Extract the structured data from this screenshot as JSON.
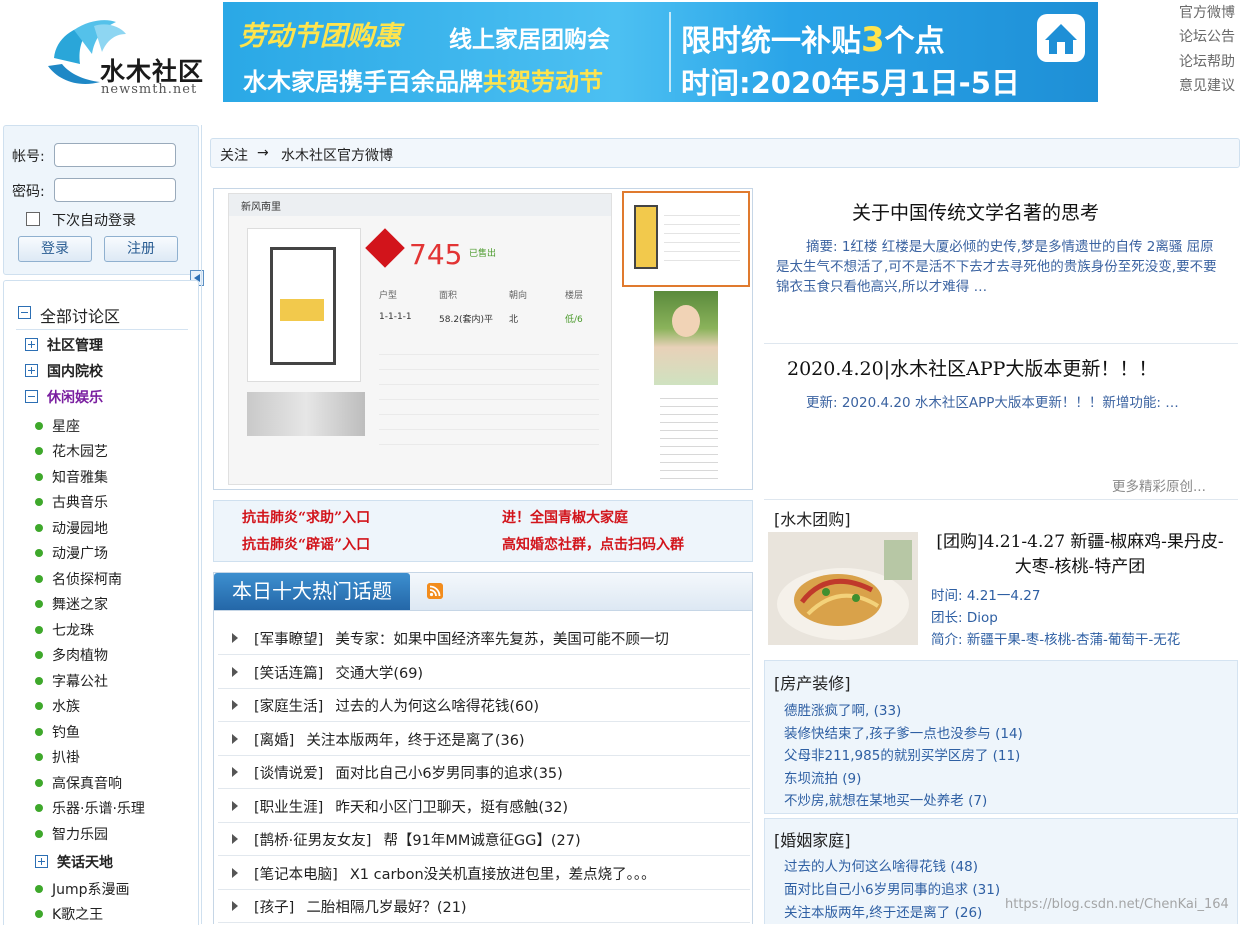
{
  "header": {
    "logo_name": "水木社区",
    "logo_domain": "newsmth.net",
    "banner": {
      "line1": "劳动节团购惠",
      "line2": "线上家居团购会",
      "line3_pre": "水木家居携手百余品牌",
      "line3_hl": "共贺劳动节",
      "line4_pre": "限时统一补贴",
      "line4_hl": "3",
      "line4_post": "个点",
      "line5": "时间:2020年5月1日-5日"
    },
    "top_links": [
      "官方微博",
      "论坛公告",
      "论坛帮助",
      "意见建议"
    ]
  },
  "login": {
    "account_label": "帐号:",
    "password_label": "密码:",
    "remember_label": "下次自动登录",
    "login_button": "登录",
    "register_button": "注册"
  },
  "sidebar": {
    "root": "全部讨论区",
    "groups": [
      {
        "label": "社区管理",
        "state": "collapsed"
      },
      {
        "label": "国内院校",
        "state": "collapsed"
      },
      {
        "label": "休闲娱乐",
        "state": "expanded"
      }
    ],
    "leaves": [
      "星座",
      "花木园艺",
      "知音雅集",
      "古典音乐",
      "动漫园地",
      "动漫广场",
      "名侦探柯南",
      "舞迷之家",
      "七龙珠",
      "多肉植物",
      "字幕公社",
      "水族",
      "钓鱼",
      "扒褂",
      "高保真音响",
      "乐器·乐谱·乐理",
      "智力乐园"
    ],
    "subgroup": "笑话天地",
    "subleaves": [
      "Jump系漫画",
      "K歌之王"
    ]
  },
  "breadcrumb": {
    "follow": "关注",
    "arrow": "→",
    "target": "水木社区官方微博"
  },
  "slide": {
    "shot_title": "新风南里",
    "price": "745",
    "price_tag": "已售出",
    "col_headers": [
      "户型",
      "面积",
      "朝向",
      "楼层"
    ],
    "row": [
      "1-1-1-1",
      "58.2(套内)平",
      "北",
      "低/6"
    ]
  },
  "red_links": [
    "抗击肺炎“求助”入口",
    "进！全国青椒大家庭",
    "抗击肺炎“辟谣”入口",
    "高知婚恋社群，点击扫码入群"
  ],
  "hot": {
    "title": "本日十大热门话题",
    "items": [
      {
        "board": "[军事瞭望]",
        "title": "美专家：如果中国经济率先复苏，美国可能不顾一切"
      },
      {
        "board": "[笑话连篇]",
        "title": "交通大学(69)"
      },
      {
        "board": "[家庭生活]",
        "title": "过去的人为何这么啥得花钱(60)"
      },
      {
        "board": "[离婚]",
        "title": "关注本版两年，终于还是离了(36)"
      },
      {
        "board": "[谈情说爱]",
        "title": "面对比自己小6岁男同事的追求(35)"
      },
      {
        "board": "[职业生涯]",
        "title": "昨天和小区门卫聊天，挺有感触(32)"
      },
      {
        "board": "[鹊桥·征男友女友]",
        "title": "帮【91年MM诚意征GG】(27)"
      },
      {
        "board": "[笔记本电脑]",
        "title": "X1 carbon没关机直接放进包里，差点烧了。。。"
      },
      {
        "board": "[孩子]",
        "title": "二胎相隔几岁最好？(21)"
      }
    ]
  },
  "articles": [
    {
      "title": "关于中国传统文学名著的思考",
      "body": "摘要: 1红楼  红楼是大厦必倾的史传,梦是多情遗世的自传 2离骚 屈原是太生气不想活了,可不是活不下去才去寻死他的贵族身份至死没变,要不要锦衣玉食只看他高兴,所以才难得 …"
    },
    {
      "title": "2020.4.20|水木社区APP大版本更新！！！",
      "body": "更新: 2020.4.20 水木社区APP大版本更新！！！新增功能: …"
    }
  ],
  "more_text": "更多精彩原创...",
  "group_buy": {
    "section": "[水木团购]",
    "title": "[团购]4.21-4.27 新疆-椒麻鸡-果丹皮-大枣-核桃-特产团",
    "time": "时间: 4.21一4.27",
    "leader": "团长: Diop",
    "intro": "简介: 新疆干果-枣-核桃-杏蒲-葡萄干-无花"
  },
  "house": {
    "section": "[房产装修]",
    "links": [
      "德胜涨疯了啊,  (33)",
      "装修快结束了,孩子爹一点也没参与  (14)",
      "父母非211,985的就别买学区房了  (11)",
      "东坝流拍  (9)",
      "不炒房,就想在某地买一处养老  (7)"
    ]
  },
  "marriage": {
    "section": "[婚姻家庭]",
    "links": [
      "过去的人为何这么啥得花钱  (48)",
      "面对比自己小6岁男同事的追求  (31)",
      "关注本版两年,终于还是离了  (26)"
    ]
  },
  "watermark": "https://blog.csdn.net/ChenKai_164",
  "colors": {
    "accent": "#2c6fb4",
    "link": "#2e5fa3",
    "red": "#d2141b",
    "bar": "#2467a8"
  }
}
